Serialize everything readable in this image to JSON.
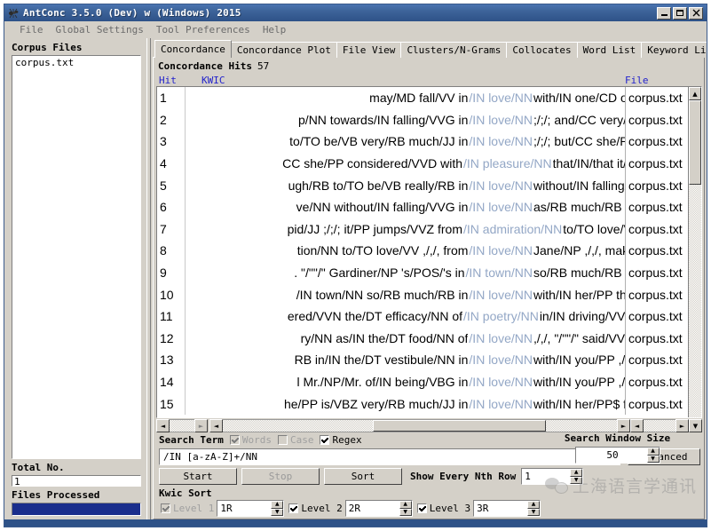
{
  "window": {
    "title": "AntConc 3.5.0 (Dev) w (Windows) 2015",
    "icon": "ant-icon",
    "minimize": "_",
    "maximize": "□",
    "close": "✕"
  },
  "menubar": {
    "items": [
      {
        "label": "File"
      },
      {
        "label": "Global Settings"
      },
      {
        "label": "Tool Preferences"
      },
      {
        "label": "Help"
      }
    ]
  },
  "sidebar": {
    "corpus_files_heading": "Corpus Files",
    "files": [
      {
        "name": "corpus.txt"
      }
    ],
    "total_no_label": "Total No.",
    "total_no_value": "1",
    "files_processed_label": "Files Processed",
    "progress_percent": 100
  },
  "tabs": [
    {
      "label": "Concordance",
      "active": true
    },
    {
      "label": "Concordance Plot",
      "active": false
    },
    {
      "label": "File View",
      "active": false
    },
    {
      "label": "Clusters/N-Grams",
      "active": false
    },
    {
      "label": "Collocates",
      "active": false
    },
    {
      "label": "Word List",
      "active": false
    },
    {
      "label": "Keyword List",
      "active": false
    }
  ],
  "concordance": {
    "hits_label": "Concordance Hits",
    "hits_count": "57",
    "columns": {
      "hit": "Hit",
      "kwic": "KWIC",
      "file": "File"
    },
    "rows": [
      {
        "num": "1",
        "left": "may/MD fall/VV in",
        "hit": "/IN love/NN",
        "right": "with/IN one/CD of/",
        "file": "corpus.txt"
      },
      {
        "num": "2",
        "left": "p/NN towards/IN falling/VVG in",
        "hit": "/IN love/NN",
        "right": ";/;/; and/CC very/RB",
        "file": "corpus.txt"
      },
      {
        "num": "3",
        "left": "to/TO be/VB very/RB much/JJ in",
        "hit": "/IN love/NN",
        "right": ";/;/; but/CC she/PP",
        "file": "corpus.txt"
      },
      {
        "num": "4",
        "left": "CC she/PP considered/VVD with",
        "hit": "/IN pleasure/NN",
        "right": "that/IN/that it/",
        "file": "corpus.txt"
      },
      {
        "num": "5",
        "left": "ugh/RB to/TO be/VB really/RB in",
        "hit": "/IN love/NN",
        "right": "without/IN falling/V",
        "file": "corpus.txt"
      },
      {
        "num": "6",
        "left": "ve/NN without/IN falling/VVG in",
        "hit": "/IN love/NN",
        "right": "as/RB much/RB as/",
        "file": "corpus.txt"
      },
      {
        "num": "7",
        "left": "pid/JJ ;/;/; it/PP jumps/VVZ from",
        "hit": "/IN admiration/NN",
        "right": "to/TO love/V",
        "file": "corpus.txt"
      },
      {
        "num": "8",
        "left": "tion/NN to/TO love/VV ,/,/, from",
        "hit": "/IN love/NN",
        "right": "Jane/NP ,/,/, make/",
        "file": "corpus.txt"
      },
      {
        "num": "9",
        "left": ". \"/\"\"/\" Gardiner/NP 's/POS/'s in",
        "hit": "/IN town/NN",
        "right": "so/RB much/RB in",
        "file": "corpus.txt"
      },
      {
        "num": "10",
        "left": "/IN town/NN so/RB much/RB in",
        "hit": "/IN love/NN",
        "right": "with/IN her/PP that",
        "file": "corpus.txt"
      },
      {
        "num": "11",
        "left": "ered/VVN the/DT efficacy/NN of",
        "hit": "/IN poetry/NN",
        "right": "in/IN driving/VV",
        "file": "corpus.txt"
      },
      {
        "num": "12",
        "left": "ry/NN as/IN the/DT food/NN of",
        "hit": "/IN love/NN",
        "right": ",/,/, \"/\"\"/\" said/VVD",
        "file": "corpus.txt"
      },
      {
        "num": "13",
        "left": "RB in/IN the/DT vestibule/NN in",
        "hit": "/IN love/NN",
        "right": "with/IN you/PP ,/,/,",
        "file": "corpus.txt"
      },
      {
        "num": "14",
        "left": "l Mr./NP/Mr. of/IN being/VBG in",
        "hit": "/IN love/NN",
        "right": "with/IN you/PP ,/,/,",
        "file": "corpus.txt"
      },
      {
        "num": "15",
        "left": "he/PP is/VBZ very/RB much/JJ in",
        "hit": "/IN love/NN",
        "right": "with/IN her/PP$ fri",
        "file": "corpus.txt"
      }
    ]
  },
  "search": {
    "term_label": "Search Term",
    "words_label": "Words",
    "words_checked": true,
    "words_enabled": false,
    "case_label": "Case",
    "case_checked": false,
    "case_enabled": false,
    "regex_label": "Regex",
    "regex_checked": true,
    "regex_enabled": true,
    "term_value": "/IN [a-zA-Z]+/NN",
    "term_placeholder": "",
    "advanced_label": "Advanced",
    "start_label": "Start",
    "stop_label": "Stop",
    "sort_label": "Sort",
    "show_nth_label": "Show Every Nth Row",
    "show_nth_value": "1",
    "window_size_label": "Search Window Size",
    "window_size_value": "50"
  },
  "kwic_sort": {
    "heading": "Kwic Sort",
    "levels": [
      {
        "label": "Level 1",
        "value": "1R",
        "checked": true,
        "enabled": false
      },
      {
        "label": "Level 2",
        "value": "2R",
        "checked": true,
        "enabled": true
      },
      {
        "label": "Level 3",
        "value": "3R",
        "checked": true,
        "enabled": true
      }
    ]
  },
  "watermark": {
    "text": "上海语言学通讯",
    "icon": "wechat-icon"
  },
  "icons": {
    "scroll_up": "▲",
    "scroll_down": "▼",
    "scroll_left": "◄",
    "scroll_right": "►",
    "spin_up": "▲",
    "spin_down": "▼"
  }
}
